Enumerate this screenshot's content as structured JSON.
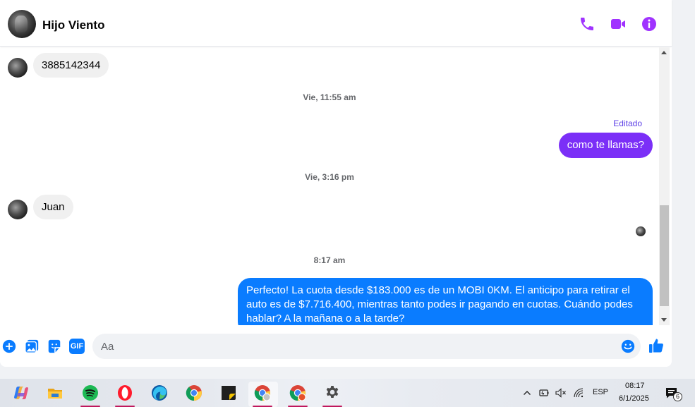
{
  "header": {
    "contact_name": "Hijo Viento",
    "icons": [
      "phone-icon",
      "video-call-icon",
      "info-icon"
    ],
    "accent_color": "#a033ff"
  },
  "messages": {
    "incoming_1": "3885142344",
    "time_1": "Vie, 11:55 am",
    "edited_label": "Editado",
    "outgoing_1": "como te llamas?",
    "time_2": "Vie, 3:16 pm",
    "incoming_2": "Juan",
    "time_3": "8:17 am",
    "outgoing_2": "Perfecto! La cuota desde $183.000 es de un MOBI 0KM. El anticipo para retirar el auto es de $7.716.400, mientras tanto podes ir pagando en cuotas. Cuándo podes hablar? A la mañana o a la tarde?",
    "outgoing_1_color": "#7b2ff7",
    "outgoing_2_color": "#0a7cff"
  },
  "composer": {
    "placeholder": "Aa",
    "icons": [
      "add-icon",
      "image-icon",
      "sticker-icon",
      "gif-icon",
      "emoji-icon",
      "like-icon"
    ],
    "gif_label": "GIF"
  },
  "taskbar": {
    "apps": [
      "copilot-icon",
      "file-explorer-icon",
      "spotify-icon",
      "opera-icon",
      "edge-icon",
      "chrome-icon",
      "sticky-notes-icon",
      "chrome-profile-icon",
      "chrome-profile-2-icon",
      "settings-icon"
    ],
    "language": "ESP",
    "time": "08:17",
    "date": "6/1/2025",
    "notification_count": "6"
  }
}
